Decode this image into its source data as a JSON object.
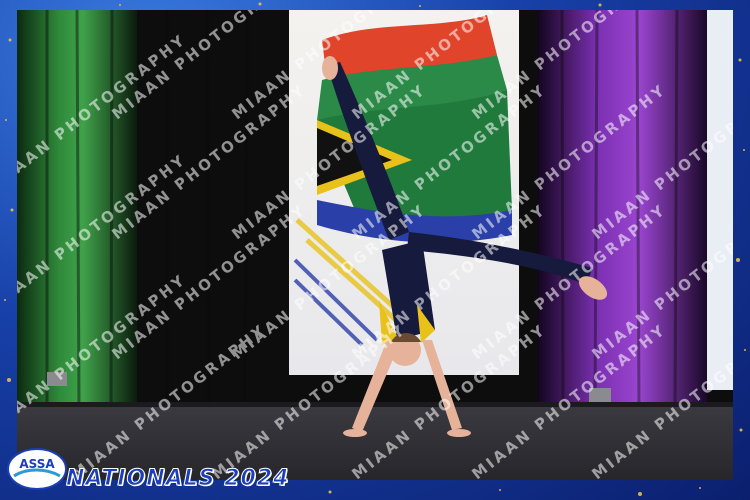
{
  "event_label": "NATIONALS 2024",
  "logo": {
    "icon": "assa-logo-icon",
    "text": "ASSA"
  },
  "watermark": {
    "text": "MIAAN PHOTOGRAPHY"
  },
  "scene": {
    "subject": "gymnast performing a handstand split on stage",
    "elements": [
      "green stage curtain",
      "black stage curtain",
      "purple stage curtain",
      "flag banner",
      "stage floor",
      "stage lights"
    ]
  },
  "colors": {
    "frame_blue": "#1740a8",
    "curtain_green": "#2f8a3a",
    "curtain_purple": "#7a2fb0",
    "curtain_black": "#0d0d0d",
    "floor": "#4a4a50",
    "leotard_navy": "#161a3c",
    "leotard_yellow": "#e8c21a"
  }
}
